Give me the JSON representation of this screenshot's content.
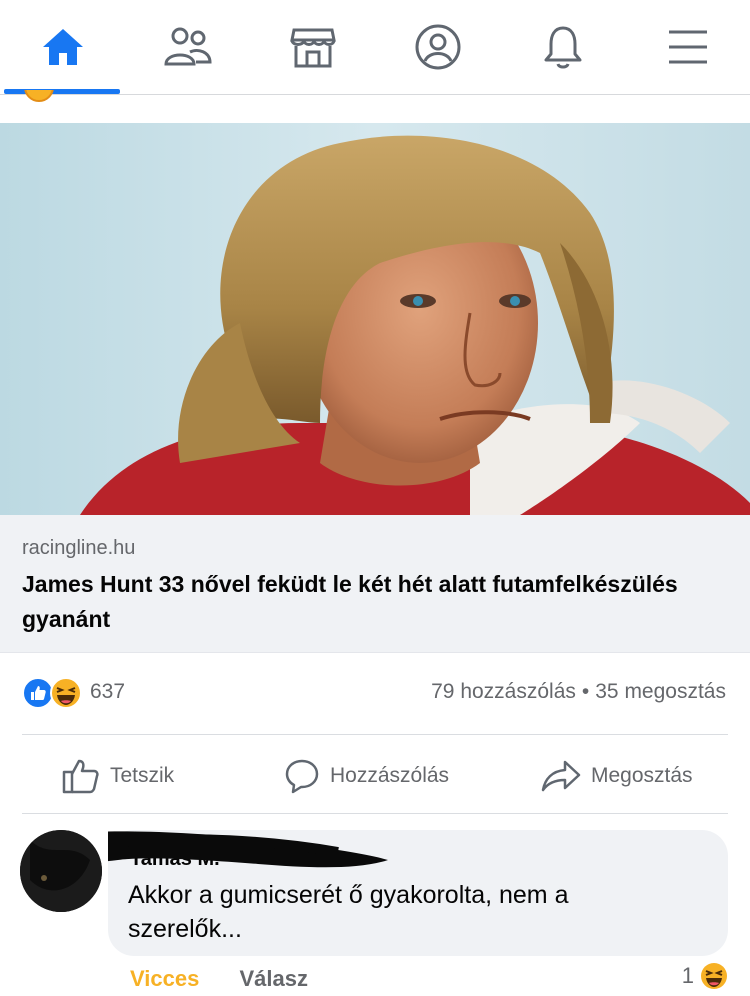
{
  "nav": {
    "items": [
      {
        "name": "home",
        "icon": "home-icon",
        "active": true
      },
      {
        "name": "friends",
        "icon": "friends-icon",
        "active": false
      },
      {
        "name": "marketplace",
        "icon": "marketplace-icon",
        "active": false
      },
      {
        "name": "profile",
        "icon": "profile-icon",
        "active": false
      },
      {
        "name": "notifications",
        "icon": "bell-icon",
        "active": false
      },
      {
        "name": "menu",
        "icon": "menu-icon",
        "active": false
      }
    ],
    "accent_color": "#1877f2"
  },
  "post": {
    "link": {
      "domain": "racingline.hu",
      "title": "James Hunt 33 nővel feküdt le két hét alatt futamfelkészülés gyanánt"
    },
    "stats": {
      "reaction_icons": [
        "like-icon",
        "haha-icon"
      ],
      "reaction_count": "637",
      "comments": "79 hozzászólás",
      "separator": "•",
      "shares": "35 megosztás"
    },
    "actions": {
      "like": "Tetszik",
      "comment": "Hozzászólás",
      "share": "Megosztás"
    }
  },
  "comment": {
    "text": "Akkor a gumicserét ő gyakorolta, nem a szerelők...",
    "funny_label": "Vicces",
    "funny_color": "#f7b125",
    "reply_label": "Válasz",
    "reaction_count": "1",
    "reaction_icon": "haha-icon"
  }
}
